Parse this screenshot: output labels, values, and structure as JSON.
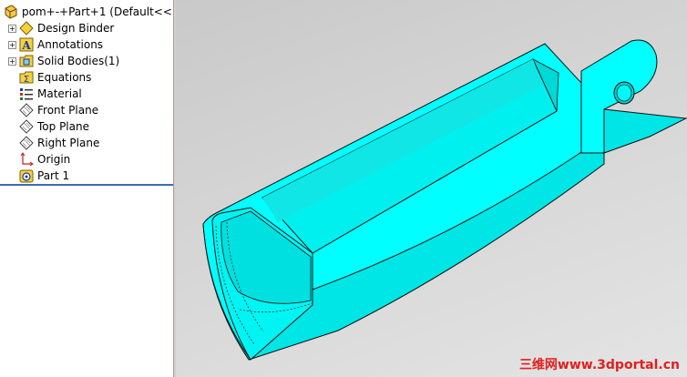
{
  "tree": {
    "root_label": "pom+-+Part+1  (Default<<D",
    "items": [
      {
        "label": "Design Binder",
        "icon": "design-binder-icon",
        "expandable": true
      },
      {
        "label": "Annotations",
        "icon": "annotations-icon",
        "expandable": true
      },
      {
        "label": "Solid Bodies(1)",
        "icon": "solid-bodies-icon",
        "expandable": true
      },
      {
        "label": "Equations",
        "icon": "equations-icon",
        "expandable": false
      },
      {
        "label": "Material",
        "icon": "material-icon",
        "expandable": false
      },
      {
        "label": "Front Plane",
        "icon": "plane-icon",
        "expandable": false
      },
      {
        "label": "Top Plane",
        "icon": "plane-icon",
        "expandable": false
      },
      {
        "label": "Right Plane",
        "icon": "plane-icon",
        "expandable": false
      },
      {
        "label": "Origin",
        "icon": "origin-icon",
        "expandable": false
      },
      {
        "label": "Part 1",
        "icon": "part-icon",
        "expandable": false
      }
    ]
  },
  "viewport": {
    "model_color": "#00ffff",
    "watermark": "三维网www.3dportal.cn"
  }
}
